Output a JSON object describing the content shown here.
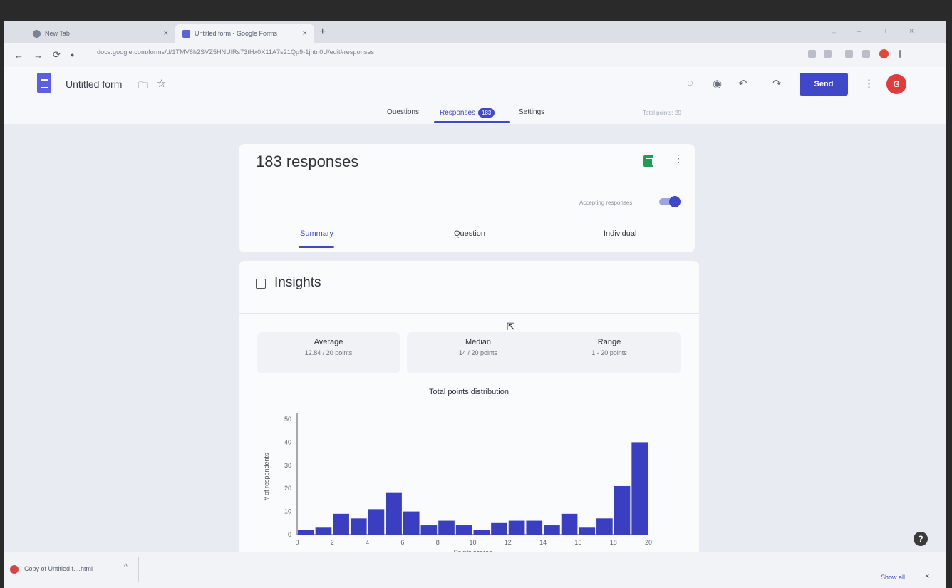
{
  "browser": {
    "tabs": [
      {
        "label": "New Tab"
      },
      {
        "label": "Untitled form - Google Forms"
      }
    ],
    "url": "docs.google.com/forms/d/1TMV8h2SVZ5HNUlRs73tHx0X11A7s21Qp9-1jhtn0U/edit#responses"
  },
  "form": {
    "title": "Untitled form",
    "send_label": "Send",
    "avatar_letter": "G",
    "nav_tabs": [
      {
        "label": "Questions"
      },
      {
        "label": "Responses",
        "badge": "183"
      },
      {
        "label": "Settings"
      }
    ],
    "total_points": "Total points: 20"
  },
  "responses": {
    "count_label": "183 responses",
    "accepting_label": "Accepting responses",
    "accepting": true,
    "subtabs": [
      {
        "label": "Summary"
      },
      {
        "label": "Question"
      },
      {
        "label": "Individual"
      }
    ]
  },
  "insights": {
    "title": "Insights",
    "stats": [
      {
        "label": "Average",
        "value": "12.84 / 20 points"
      },
      {
        "label": "Median",
        "value": "14 / 20 points"
      },
      {
        "label": "Range",
        "value": "1 - 20 points"
      }
    ],
    "chart_title": "Total points distribution"
  },
  "chart_data": {
    "type": "bar",
    "title": "Total points distribution",
    "xlabel": "Points scored",
    "ylabel": "# of respondents",
    "x": [
      1,
      2,
      3,
      4,
      5,
      6,
      7,
      8,
      9,
      10,
      11,
      12,
      13,
      14,
      15,
      16,
      17,
      18,
      19,
      20
    ],
    "values": [
      2,
      3,
      9,
      7,
      11,
      18,
      10,
      4,
      6,
      4,
      2,
      5,
      6,
      6,
      4,
      9,
      3,
      7,
      21,
      40
    ],
    "xticks": [
      0,
      2,
      4,
      6,
      8,
      10,
      12,
      14,
      16,
      18,
      20
    ],
    "yticks": [
      0,
      10,
      20,
      30,
      40,
      50
    ],
    "xlim": [
      0,
      20
    ],
    "ylim": [
      0,
      50
    ],
    "bar_color": "#3a3fc1"
  },
  "downloads": {
    "file_label": "Copy of Untitled f....html",
    "show_all_label": "Show all"
  },
  "colors": {
    "accent": "#4047c9",
    "avatar": "#e23b3b",
    "sheets": "#1f9d55"
  }
}
